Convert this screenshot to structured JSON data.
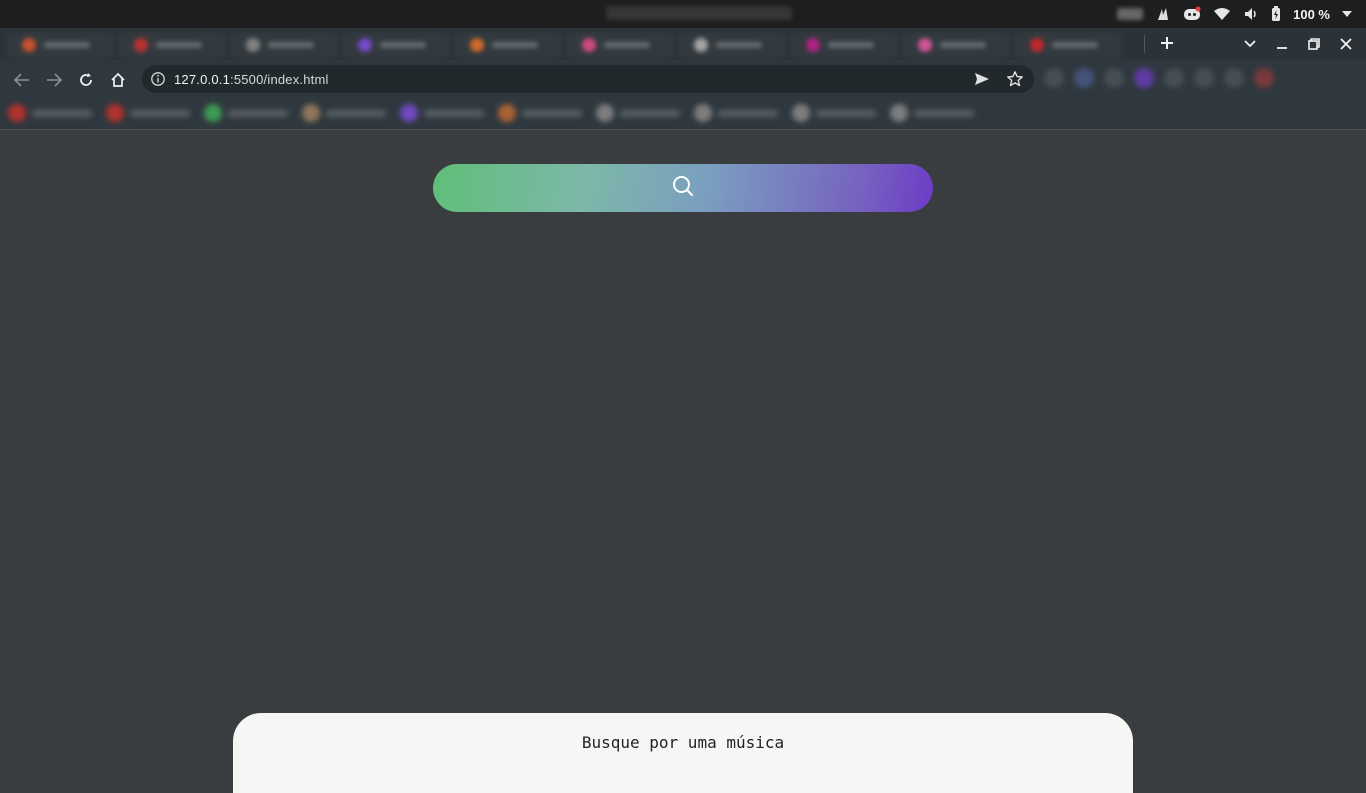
{
  "system_bar": {
    "battery_percent": "100 %"
  },
  "tab_strip": {
    "tab_colors": [
      "#d9552d",
      "#c8322b",
      "#8a8a8a",
      "#7a4dd8",
      "#e0702a",
      "#e04c8c",
      "#b0b0b0",
      "#c0208c",
      "#e05aa0",
      "#d02828"
    ]
  },
  "address_bar": {
    "url_host": "127.0.0.1",
    "url_rest": ":5500/index.html"
  },
  "bookmarks": {
    "colors": [
      "#c8322b",
      "#c8322b",
      "#3faa5a",
      "#a08060",
      "#7a4dd8",
      "#c06a30",
      "#8a8a8a",
      "#8a8a8a",
      "#8a8a8a",
      "#8a8a8a"
    ]
  },
  "page": {
    "search_icon": "search-icon",
    "gradient_colors": [
      "#5fbf78",
      "#7a9ec0",
      "#6c3cc6"
    ],
    "result_message": "Busque por uma música"
  }
}
